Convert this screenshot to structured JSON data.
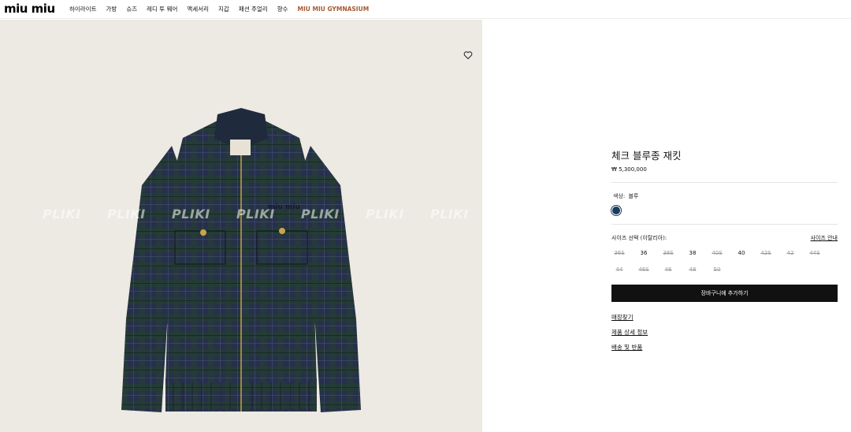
{
  "header": {
    "logo": "miu miu",
    "nav": [
      {
        "label": "하이라이트"
      },
      {
        "label": "가방"
      },
      {
        "label": "슈즈"
      },
      {
        "label": "레디 투 웨어"
      },
      {
        "label": "액세서리"
      },
      {
        "label": "지갑"
      },
      {
        "label": "패션 주얼리"
      },
      {
        "label": "향수"
      },
      {
        "label": "MIU MIU GYMNASIUM"
      }
    ]
  },
  "image": {
    "watermark": "PLIKI",
    "wishlist_icon": "heart-outline-icon"
  },
  "product": {
    "title": "체크 블루종 재킷",
    "price": "₩ 5,300,000",
    "color_label": "색상:",
    "color_value": "블루",
    "swatch_color": "#173c5e",
    "size_label": "사이즈 선택 (이탈리아):",
    "size_guide": "사이즈 안내",
    "sizes": [
      {
        "label": "36S",
        "available": false
      },
      {
        "label": "36",
        "available": true
      },
      {
        "label": "38S",
        "available": false
      },
      {
        "label": "38",
        "available": true
      },
      {
        "label": "40S",
        "available": false
      },
      {
        "label": "40",
        "available": true
      },
      {
        "label": "42S",
        "available": false
      },
      {
        "label": "42",
        "available": false
      },
      {
        "label": "44S",
        "available": false
      },
      {
        "label": "44",
        "available": false
      },
      {
        "label": "46S",
        "available": false
      },
      {
        "label": "46",
        "available": false
      },
      {
        "label": "48",
        "available": false
      },
      {
        "label": "50",
        "available": false
      }
    ],
    "add_to_cart": "장바구니에 추가하기",
    "links": [
      {
        "label": "매장찾기"
      },
      {
        "label": "제품 상세 정보"
      },
      {
        "label": "배송 및 반품"
      }
    ]
  }
}
